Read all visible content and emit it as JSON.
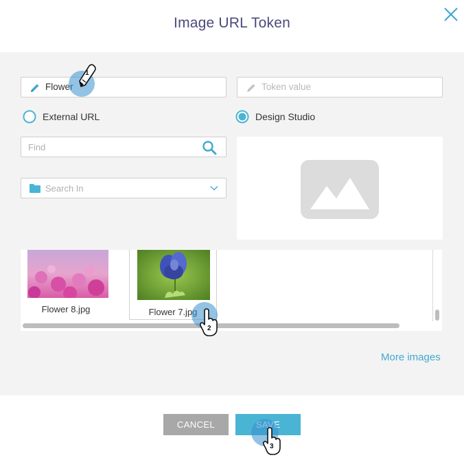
{
  "dialog": {
    "title": "Image URL Token"
  },
  "form": {
    "token_name_value": "Flower",
    "token_value_placeholder": "Token value",
    "radio_options": [
      {
        "label": "External URL",
        "selected": false
      },
      {
        "label": "Design Studio",
        "selected": true
      }
    ],
    "find_placeholder": "Find",
    "search_in_placeholder": "Search In"
  },
  "gallery": {
    "items": [
      {
        "label": "Flower 8.jpg"
      },
      {
        "label": "Flower 7.jpg"
      }
    ],
    "more_images_label": "More images"
  },
  "footer": {
    "cancel_label": "CANCEL",
    "save_label": "SAVE"
  },
  "annotations": {
    "step_markers": [
      "1",
      "2",
      "3"
    ]
  },
  "colors": {
    "accent": "#4ab4d4",
    "link": "#42a9d0",
    "title": "#4a4a7a",
    "cancel_button": "#a8a8a8",
    "panel_background": "#f3f3f3"
  },
  "icons": [
    "close-icon",
    "pencil-icon",
    "search-icon",
    "folder-icon",
    "chevron-down-icon",
    "image-placeholder-icon",
    "hand-cursor-icon"
  ]
}
